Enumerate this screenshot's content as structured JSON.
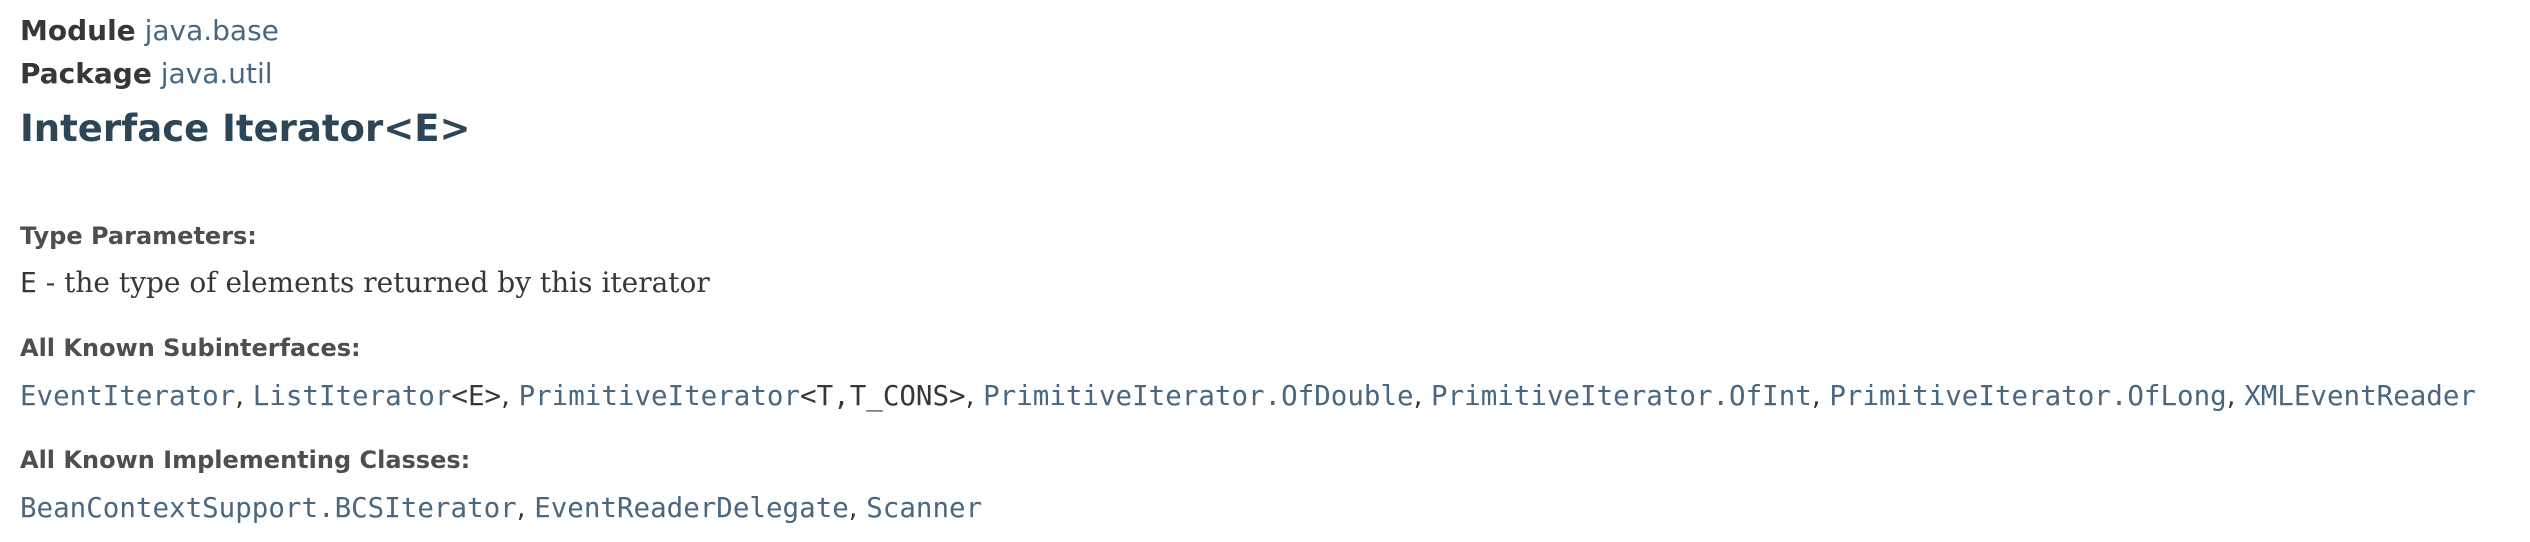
{
  "header": {
    "module_label": "Module",
    "module_name": "java.base",
    "package_label": "Package",
    "package_name": "java.util",
    "title": "Interface Iterator<E>"
  },
  "type_parameters": {
    "heading": "Type Parameters:",
    "param_name": "E",
    "param_desc": " - the type of elements returned by this iterator"
  },
  "subinterfaces": {
    "heading": "All Known Subinterfaces:",
    "items": [
      {
        "link": "EventIterator",
        "suffix": ""
      },
      {
        "link": "ListIterator",
        "suffix": "<E>"
      },
      {
        "link": "PrimitiveIterator",
        "suffix": "<T,T_CONS>"
      },
      {
        "link": "PrimitiveIterator.OfDouble",
        "suffix": ""
      },
      {
        "link": "PrimitiveIterator.OfInt",
        "suffix": ""
      },
      {
        "link": "PrimitiveIterator.OfLong",
        "suffix": ""
      },
      {
        "link": "XMLEventReader",
        "suffix": ""
      }
    ],
    "separator": ", "
  },
  "implementing_classes": {
    "heading": "All Known Implementing Classes:",
    "items": [
      {
        "link": "BeanContextSupport.BCSIterator"
      },
      {
        "link": "EventReaderDelegate"
      },
      {
        "link": "Scanner"
      }
    ],
    "separator": ", "
  }
}
